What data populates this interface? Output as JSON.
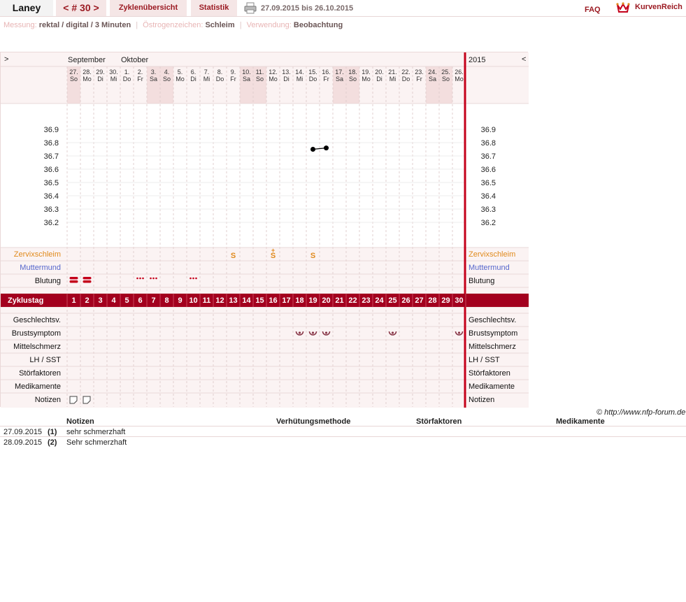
{
  "header": {
    "user": "Laney",
    "cycle_prev": "<",
    "cycle_num": "# 30",
    "cycle_next": ">",
    "overview": "Zyklenübersicht",
    "stats": "Statistik",
    "daterange": "27.09.2015 bis 26.10.2015",
    "faq": "FAQ",
    "logo_text": "KurvenReich",
    "accent": "#9b1a22"
  },
  "settings": {
    "measure_label": "Messung:",
    "measure_value": "rektal / digital / 3 Minuten",
    "estrogen_label": "Östrogenzeichen:",
    "estrogen_value": "Schleim",
    "use_label": "Verwendung:",
    "use_value": "Beobachtung"
  },
  "chart": {
    "nav_left": ">",
    "nav_right": "<",
    "month1": "September",
    "month2": "Oktober",
    "year": "2015",
    "days": [
      {
        "d": "27.",
        "w": "So",
        "we": true
      },
      {
        "d": "28.",
        "w": "Mo",
        "we": false
      },
      {
        "d": "29.",
        "w": "Di",
        "we": false
      },
      {
        "d": "30.",
        "w": "Mi",
        "we": false
      },
      {
        "d": "1.",
        "w": "Do",
        "we": false
      },
      {
        "d": "2.",
        "w": "Fr",
        "we": false
      },
      {
        "d": "3.",
        "w": "Sa",
        "we": true
      },
      {
        "d": "4.",
        "w": "So",
        "we": true
      },
      {
        "d": "5.",
        "w": "Mo",
        "we": false
      },
      {
        "d": "6.",
        "w": "Di",
        "we": false
      },
      {
        "d": "7.",
        "w": "Mi",
        "we": false
      },
      {
        "d": "8.",
        "w": "Do",
        "we": false
      },
      {
        "d": "9.",
        "w": "Fr",
        "we": false
      },
      {
        "d": "10.",
        "w": "Sa",
        "we": true
      },
      {
        "d": "11.",
        "w": "So",
        "we": true
      },
      {
        "d": "12.",
        "w": "Mo",
        "we": false
      },
      {
        "d": "13.",
        "w": "Di",
        "we": false
      },
      {
        "d": "14.",
        "w": "Mi",
        "we": false
      },
      {
        "d": "15.",
        "w": "Do",
        "we": false
      },
      {
        "d": "16.",
        "w": "Fr",
        "we": false
      },
      {
        "d": "17.",
        "w": "Sa",
        "we": true
      },
      {
        "d": "18.",
        "w": "So",
        "we": true
      },
      {
        "d": "19.",
        "w": "Mo",
        "we": false
      },
      {
        "d": "20.",
        "w": "Di",
        "we": false
      },
      {
        "d": "21.",
        "w": "Mi",
        "we": false
      },
      {
        "d": "22.",
        "w": "Do",
        "we": false
      },
      {
        "d": "23.",
        "w": "Fr",
        "we": false
      },
      {
        "d": "24.",
        "w": "Sa",
        "we": true
      },
      {
        "d": "25.",
        "w": "So",
        "we": true
      },
      {
        "d": "26.",
        "w": "Mo",
        "we": false
      }
    ],
    "temp_ticks": [
      "36.9",
      "36.8",
      "36.7",
      "36.6",
      "36.5",
      "36.4",
      "36.3",
      "36.2"
    ],
    "temperatures": [
      {
        "day": 19,
        "value": 36.75
      },
      {
        "day": 20,
        "value": 36.76
      }
    ],
    "row_labels": {
      "zervix": "Zervixschleim",
      "muttermund": "Muttermund",
      "blutung": "Blutung",
      "zyklustag": "Zyklustag",
      "geschlechtsv": "Geschlechtsv.",
      "brust": "Brustsymptom",
      "mittelschmerz": "Mittelschmerz",
      "lh": "LH / SST",
      "stoer": "Störfaktoren",
      "medi": "Medikamente",
      "notizen": "Notizen"
    },
    "zervix_marks": [
      {
        "day": 13,
        "sym": "S"
      },
      {
        "day": 16,
        "sym": "S+"
      },
      {
        "day": 19,
        "sym": "S"
      }
    ],
    "bleeding": [
      {
        "day": 1,
        "kind": "heavy"
      },
      {
        "day": 2,
        "kind": "heavy"
      },
      {
        "day": 6,
        "kind": "spot"
      },
      {
        "day": 7,
        "kind": "spot"
      },
      {
        "day": 10,
        "kind": "spot"
      }
    ],
    "breast": [
      18,
      19,
      20,
      25,
      30
    ],
    "note_days": [
      1,
      2
    ],
    "zyklustag_values": [
      "1",
      "2",
      "3",
      "4",
      "5",
      "6",
      "7",
      "8",
      "9",
      "10",
      "11",
      "12",
      "13",
      "14",
      "15",
      "16",
      "17",
      "18",
      "19",
      "20",
      "21",
      "22",
      "23",
      "24",
      "25",
      "26",
      "27",
      "28",
      "29",
      "30"
    ],
    "colors": {
      "weekend": "#f3dede",
      "bar": "#a3001e",
      "temp_line": "#000000",
      "zervix": "#e08a1c",
      "muttermund": "#5566cc",
      "bleed": "#c4001a",
      "breast": "#8a3a4a"
    }
  },
  "copyright": "© http://www.nfp-forum.de",
  "notes_table": {
    "headers": [
      "Notizen",
      "Verhütungsmethode",
      "Störfaktoren",
      "Medikamente"
    ],
    "rows": [
      {
        "date": "27.09.2015",
        "num": "(1)",
        "note": "sehr schmerzhaft"
      },
      {
        "date": "28.09.2015",
        "num": "(2)",
        "note": "Sehr schmerzhaft"
      }
    ]
  }
}
